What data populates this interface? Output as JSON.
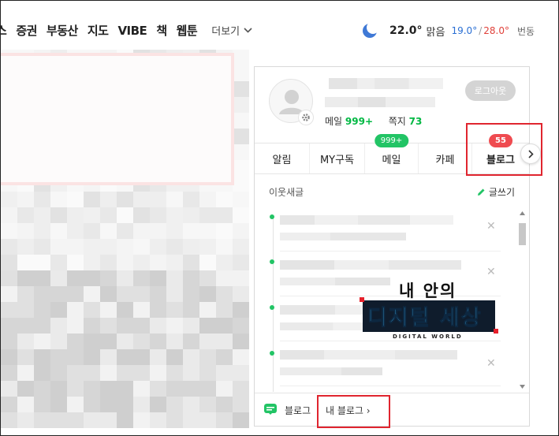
{
  "nav": {
    "items": [
      "스",
      "증권",
      "부동산",
      "지도",
      "VIBE",
      "책",
      "웹툰"
    ],
    "more_label": "더보기"
  },
  "weather": {
    "icon": "moon-icon",
    "temp": "22.0°",
    "condition": "맑음",
    "low": "19.0°",
    "separator": "/",
    "high": "28.0°",
    "change_label": "번동"
  },
  "account": {
    "logout_label": "로그아웃",
    "mail_label": "메일",
    "mail_count": "999+",
    "note_label": "쪽지",
    "note_count": "73"
  },
  "tabs": [
    {
      "label": "알림",
      "badge": ""
    },
    {
      "label": "MY구독",
      "badge": ""
    },
    {
      "label": "메일",
      "badge": "999+"
    },
    {
      "label": "카페",
      "badge": ""
    },
    {
      "label": "블로그",
      "badge": "55"
    }
  ],
  "feed": {
    "title": "이웃새글",
    "write_label": "글쓰기"
  },
  "overlay": {
    "line1": "내 안의",
    "line2": "디지털 세상",
    "line3": "DIGITAL WORLD"
  },
  "footer": {
    "blog_label": "블로그",
    "my_blog_label": "내 블로그 ›"
  },
  "colors": {
    "accent_green": "#22c465",
    "badge_red": "#ef4b50",
    "highlight_red": "#e0252f",
    "low_temp": "#2a6fd4",
    "high_temp": "#e0413a"
  }
}
